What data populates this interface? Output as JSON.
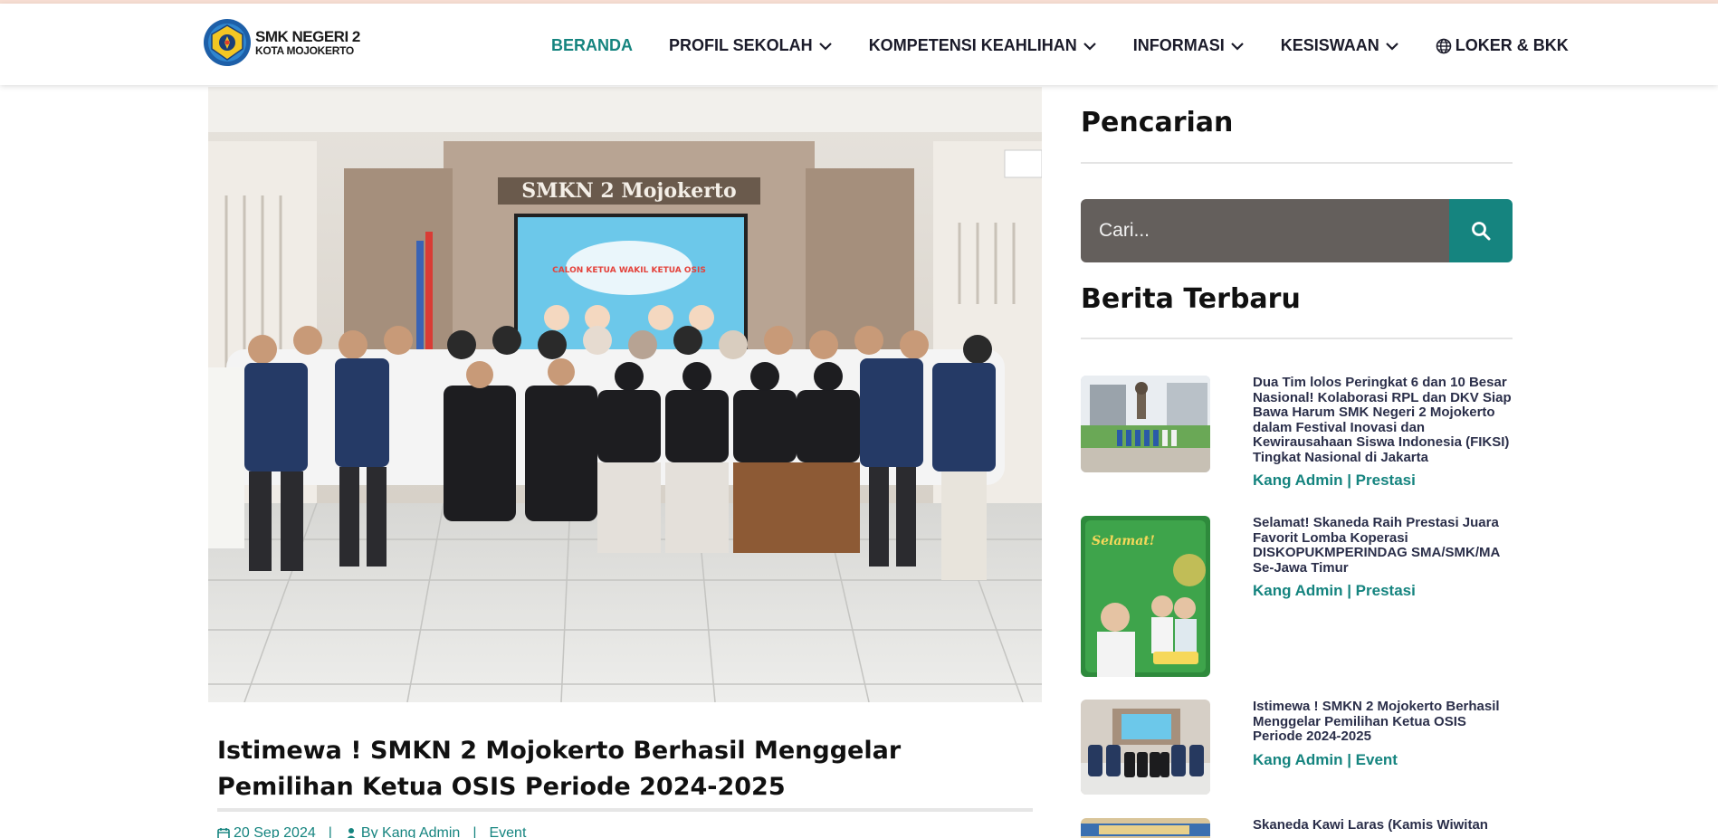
{
  "brand": {
    "line1": "SMK NEGERI 2",
    "line2": "KOTA MOJOKERTO"
  },
  "nav": {
    "items": [
      {
        "label": "BERANDA",
        "active": true,
        "dropdown": false
      },
      {
        "label": "PROFIL SEKOLAH",
        "active": false,
        "dropdown": true
      },
      {
        "label": "KOMPETENSI KEAHLIHAN",
        "active": false,
        "dropdown": true
      },
      {
        "label": "INFORMASI",
        "active": false,
        "dropdown": true
      },
      {
        "label": "KESISWAAN",
        "active": false,
        "dropdown": true
      },
      {
        "label": "LOKER & BKK",
        "active": false,
        "dropdown": false,
        "icon": "globe-icon"
      }
    ]
  },
  "hero": {
    "banner_text": "SMKN 2 Mojokerto",
    "screen_text": "CALON KETUA WAKIL KETUA OSIS"
  },
  "post": {
    "title": "Istimewa ! SMKN 2 Mojokerto Berhasil Menggelar Pemilihan Ketua OSIS Periode 2024-2025",
    "date": "20 Sep 2024",
    "author": "By Kang Admin",
    "category": "Event",
    "separator": "|"
  },
  "sidebar": {
    "search_heading": "Pencarian",
    "search_placeholder": "Cari...",
    "latest_heading": "Berita Terbaru",
    "news": [
      {
        "title": "Dua Tim lolos Peringkat 6 dan 10 Besar Nasional! Kolaborasi RPL dan DKV Siap Bawa Harum SMK Negeri 2 Mojokerto dalam Festival Inovasi dan Kewirausahaan Siswa Indonesia (FIKSI) Tingkat Nasional di Jakarta",
        "meta": "Kang Admin | Prestasi"
      },
      {
        "title": "Selamat! Skaneda Raih Prestasi Juara Favorit Lomba Koperasi DISKOPUKMPERINDAG SMA/SMK/MA Se-Jawa Timur",
        "meta": "Kang Admin | Prestasi",
        "thumb_text": "Selamat!"
      },
      {
        "title": "Istimewa ! SMKN 2 Mojokerto Berhasil Menggelar Pemilihan Ketua OSIS Periode 2024-2025",
        "meta": "Kang Admin | Event"
      },
      {
        "title": "Skaneda Kawi Laras (Kamis Wiwitan",
        "meta": ""
      }
    ]
  },
  "colors": {
    "accent": "#15847f",
    "nav_text": "#1b1b2a",
    "search_bg": "#645f5c",
    "title_text": "#2b2f4a"
  }
}
